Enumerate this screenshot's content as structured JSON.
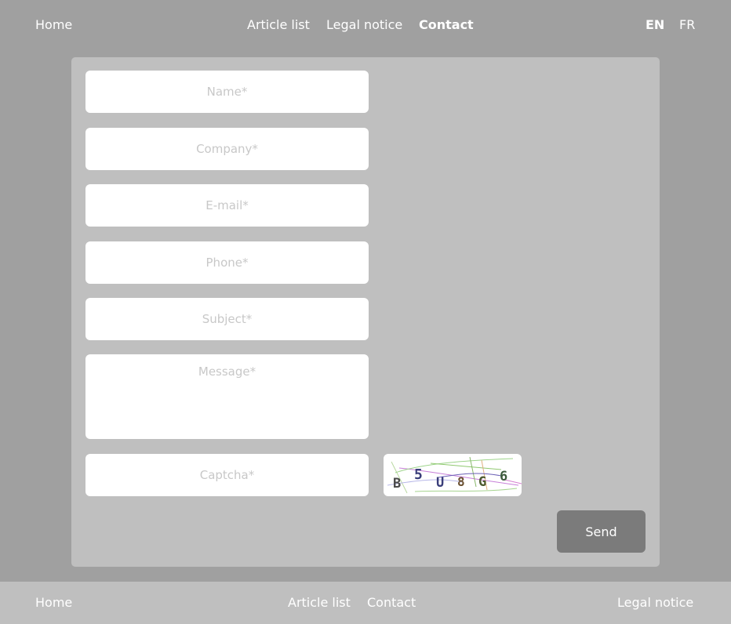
{
  "top_nav": {
    "home": "Home",
    "article_list": "Article list",
    "legal_notice": "Legal notice",
    "contact": "Contact",
    "lang_en": "EN",
    "lang_fr": "FR"
  },
  "form": {
    "name_placeholder": "Name*",
    "company_placeholder": "Company*",
    "email_placeholder": "E-mail*",
    "phone_placeholder": "Phone*",
    "subject_placeholder": "Subject*",
    "message_placeholder": "Message*",
    "captcha_placeholder": "Captcha*",
    "captcha_text": "B5U8G6",
    "send_label": "Send"
  },
  "footer": {
    "home": "Home",
    "article_list": "Article list",
    "contact": "Contact",
    "legal_notice": "Legal notice"
  },
  "colors": {
    "page_background": "#a0a0a0",
    "card_background": "#bfbfbf",
    "send_button": "#7b7b7b",
    "text_light": "#ffffff"
  }
}
